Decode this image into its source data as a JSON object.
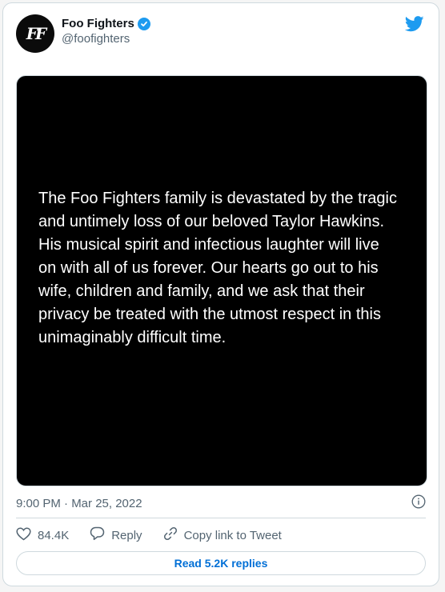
{
  "account": {
    "display_name": "Foo Fighters",
    "handle": "@foofighters",
    "avatar_text": "FF"
  },
  "media": {
    "text": "The Foo Fighters family is devastated by the tragic\nand untimely loss of our beloved Taylor Hawkins.\nHis musical spirit and infectious laughter will live\non with all of us forever. Our hearts go out to his\nwife, children and family, and we ask that their\nprivacy be treated with the utmost respect in this\nunimaginably difficult time."
  },
  "meta": {
    "timestamp": "9:00 PM · Mar 25, 2022"
  },
  "actions": {
    "likes": "84.4K",
    "reply_label": "Reply",
    "copy_link_label": "Copy link to Tweet"
  },
  "read_replies_label": "Read 5.2K replies",
  "colors": {
    "accent": "#1d9bf0",
    "link": "#006fd6",
    "muted": "#536471",
    "border": "#cfd9de"
  },
  "icons": [
    "verified-badge-icon",
    "twitter-bird-icon",
    "info-icon",
    "heart-icon",
    "reply-icon",
    "link-icon"
  ]
}
